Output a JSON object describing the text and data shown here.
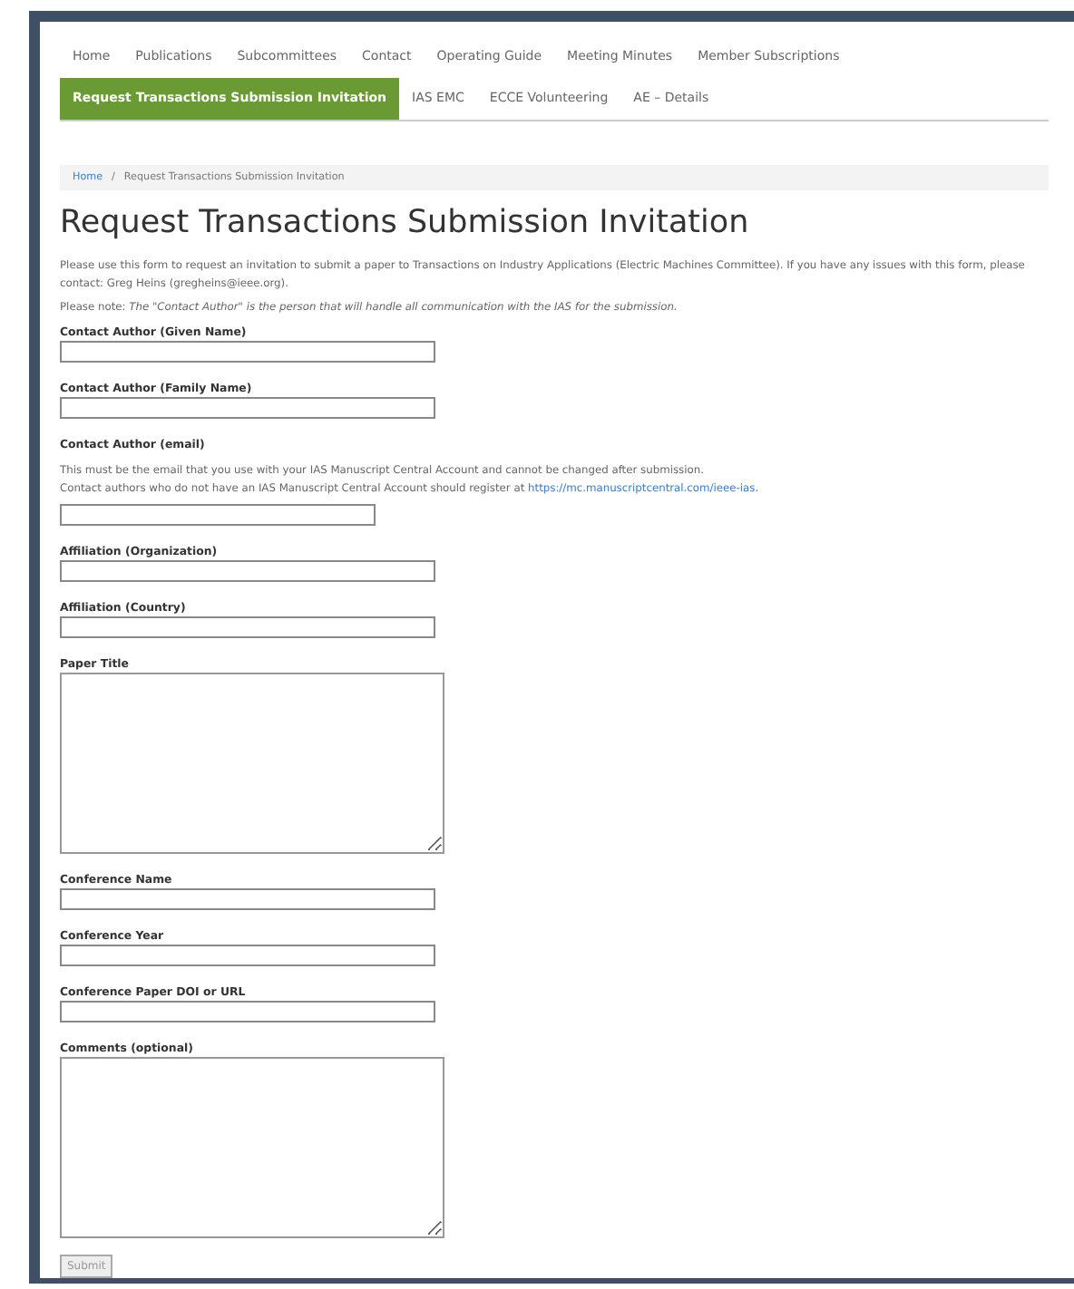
{
  "nav": {
    "items": [
      {
        "label": "Home",
        "selected": false
      },
      {
        "label": "Publications",
        "selected": false
      },
      {
        "label": "Subcommittees",
        "selected": false
      },
      {
        "label": "Contact",
        "selected": false
      },
      {
        "label": "Operating Guide",
        "selected": false
      },
      {
        "label": "Meeting Minutes",
        "selected": false
      },
      {
        "label": "Member Subscriptions",
        "selected": false
      },
      {
        "label": "Request Transactions Submission Invitation",
        "selected": true
      },
      {
        "label": "IAS EMC",
        "selected": false
      },
      {
        "label": "ECCE Volunteering",
        "selected": false
      },
      {
        "label": "AE – Details",
        "selected": false
      }
    ]
  },
  "breadcrumb": {
    "home": "Home",
    "separator": "/",
    "current": "Request Transactions Submission Invitation"
  },
  "title": "Request Transactions Submission Invitation",
  "intro": "Please use this form to request an invitation to submit a paper to Transactions on Industry Applications (Electric Machines Committee). If you have any issues with this form, please contact: Greg Heins (gregheins@ieee.org).",
  "note": "Please note: *The \"Contact Author\" is the person that will handle all communication with the IAS for the submission.*",
  "fields": [
    {
      "label": "Contact Author (Given Name)",
      "kind": "text"
    },
    {
      "label": "Contact Author (Family Name)",
      "kind": "text"
    },
    {
      "label": "Contact Author (email)",
      "kind": "email",
      "help": [
        "This must be the email that you use with your IAS Manuscript Central Account and cannot be changed after submission.",
        "Contact authors who do not have an IAS Manuscript Central Account should register at "
      ],
      "help_link": "https://mc.manuscriptcentral.com/ieee-ias",
      "help_end": "."
    },
    {
      "label": "Affiliation (Organization)",
      "kind": "text"
    },
    {
      "label": "Affiliation (Country)",
      "kind": "text"
    },
    {
      "label": "Paper Title",
      "kind": "textarea"
    },
    {
      "label": "Conference Name",
      "kind": "text"
    },
    {
      "label": "Conference Year",
      "kind": "text"
    },
    {
      "label": "Conference Paper DOI or URL",
      "kind": "text"
    },
    {
      "label": "Comments (optional)",
      "kind": "textarea"
    }
  ],
  "submit": "Submit"
}
